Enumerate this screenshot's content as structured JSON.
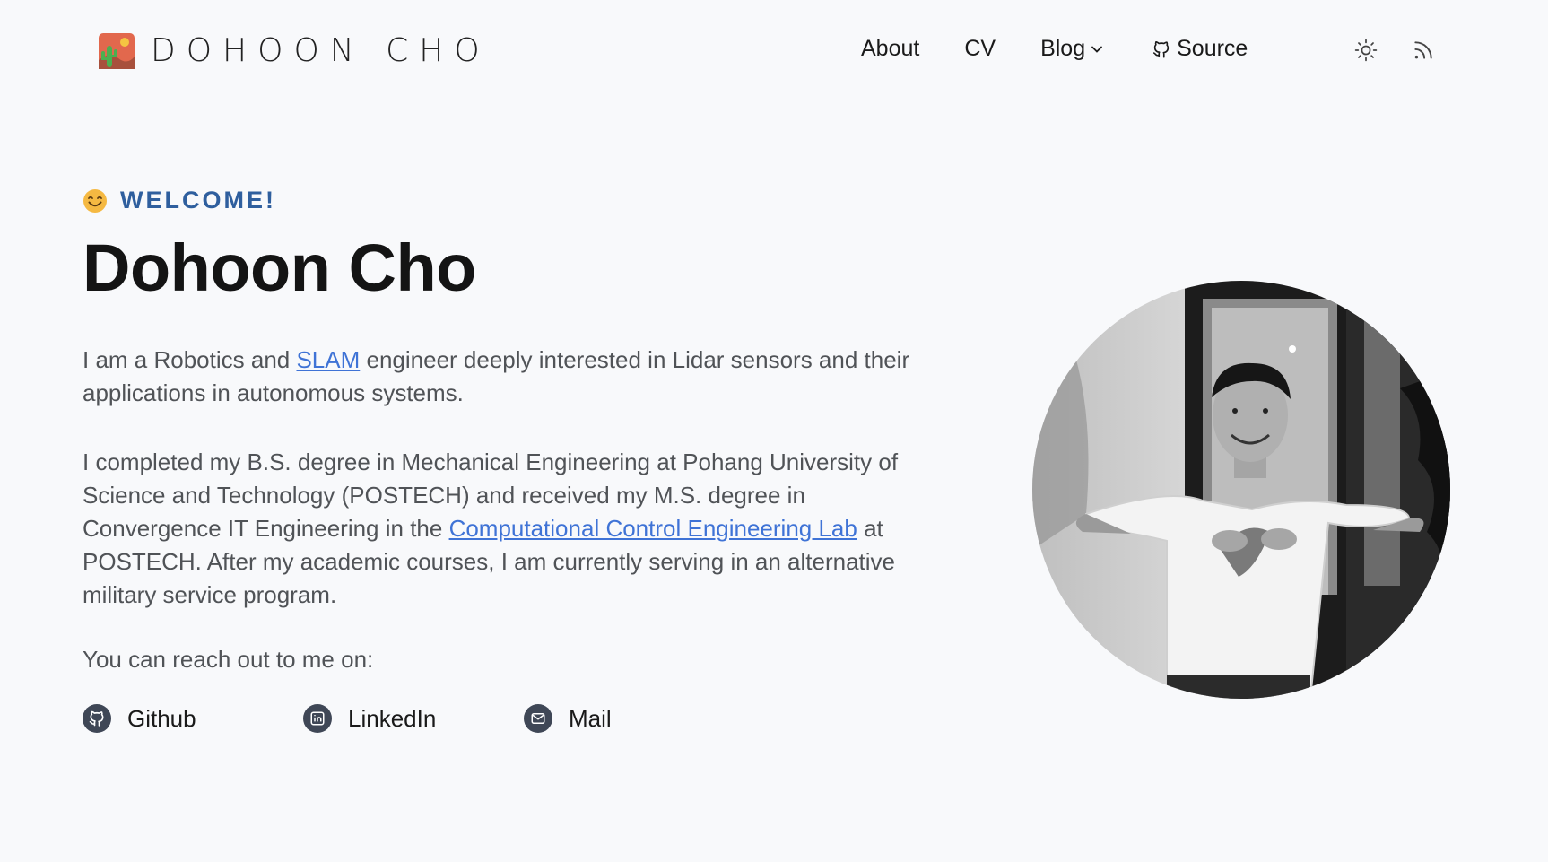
{
  "header": {
    "site_name": "DOHOON CHO",
    "nav": {
      "about": "About",
      "cv": "CV",
      "blog": "Blog",
      "source": "Source"
    }
  },
  "intro": {
    "welcome": "WELCOME!",
    "name": "Dohoon Cho",
    "para1": {
      "before": "I am a Robotics and ",
      "link": "SLAM",
      "after": " engineer deeply interested in Lidar sensors and their applications in autonomous systems."
    },
    "para2": {
      "before": "I completed my B.S. degree in Mechanical Engineering at Pohang University of Science and Technology (POSTECH) and received my M.S. degree in Convergence IT Engineering in the ",
      "link": "Computational Control Engineering Lab",
      "after": " at POSTECH. After my academic courses, I am currently serving in an alternative military service program."
    },
    "reach": "You can reach out to me on:",
    "socials": {
      "github": "Github",
      "linkedin": "LinkedIn",
      "mail": "Mail"
    }
  },
  "colors": {
    "background": "#f8f9fb",
    "accent": "#2f5f9e",
    "link": "#3f73d6",
    "icon_bg": "#3f4756"
  },
  "icons": [
    "cactus-logo-icon",
    "chevron-down-icon",
    "github-icon",
    "sun-icon",
    "rss-icon",
    "smile-emoji-icon",
    "linkedin-icon",
    "mail-icon"
  ]
}
